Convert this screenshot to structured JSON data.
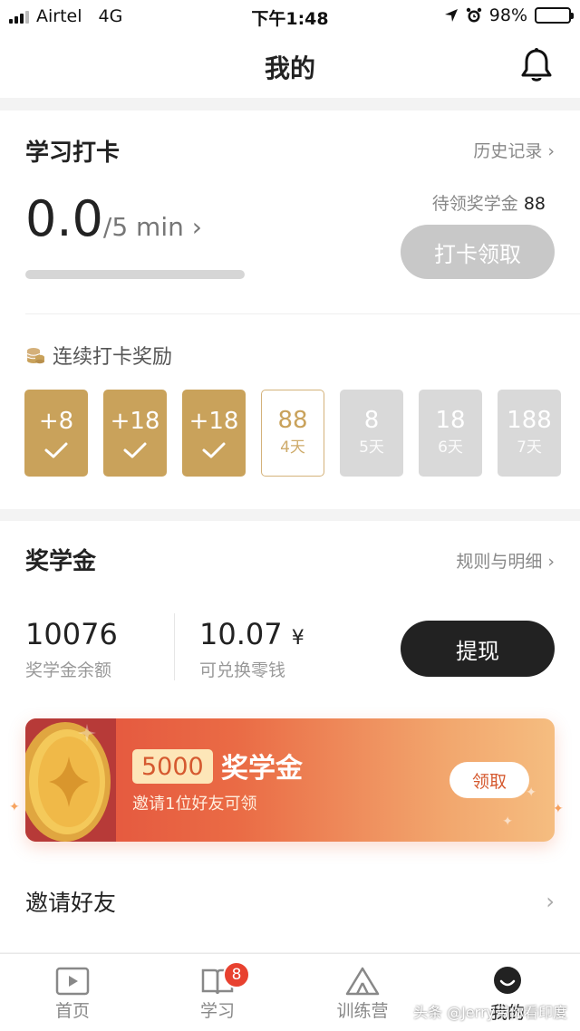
{
  "status_bar": {
    "carrier": "Airtel",
    "network": "4G",
    "time": "下午1:48",
    "battery": "98%"
  },
  "header": {
    "title": "我的"
  },
  "checkin": {
    "title": "学习打卡",
    "history_link": "历史记录",
    "minutes": "0.0",
    "goal": "/5 min",
    "progress_fraction": 0.0,
    "pending_label": "待领奖学金",
    "pending_value": "88",
    "button": "打卡领取",
    "streak_title": "连续打卡奖励",
    "days": [
      {
        "value": "+8",
        "state": "done"
      },
      {
        "value": "+18",
        "state": "done"
      },
      {
        "value": "+18",
        "state": "done"
      },
      {
        "value": "88",
        "day": "4天",
        "state": "current"
      },
      {
        "value": "8",
        "day": "5天",
        "state": "future"
      },
      {
        "value": "18",
        "day": "6天",
        "state": "future"
      },
      {
        "value": "188",
        "day": "7天",
        "state": "future"
      }
    ]
  },
  "scholarship": {
    "title": "奖学金",
    "rules_link": "规则与明细",
    "balance": "10076",
    "balance_label": "奖学金余额",
    "cash": "10.07",
    "cash_unit": "¥",
    "cash_label": "可兑换零钱",
    "withdraw": "提现",
    "banner": {
      "amount": "5000",
      "title": "奖学金",
      "subtitle": "邀请1位好友可领",
      "claim": "领取"
    },
    "invite": "邀请好友"
  },
  "tabbar": {
    "tabs": [
      {
        "label": "首页"
      },
      {
        "label": "学习",
        "badge": "8"
      },
      {
        "label": "训练营"
      },
      {
        "label": "我的"
      }
    ]
  },
  "watermark": "头条 @Jerry带你看印度",
  "colors": {
    "gold": "#c9a25b",
    "inactive": "#d9d9d9",
    "badge": "#e8412f",
    "dark_button": "#222222"
  }
}
